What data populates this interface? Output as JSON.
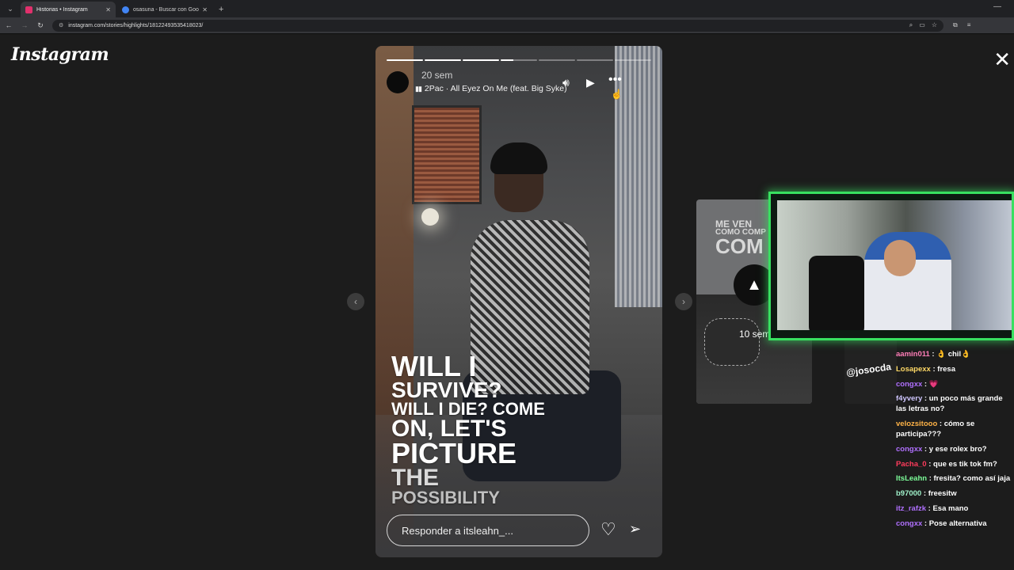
{
  "browser": {
    "tabs": [
      {
        "title": "Historias • Instagram",
        "active": true,
        "favicon_color": "#e1306c"
      },
      {
        "title": "osasuna - Buscar con Google",
        "active": false,
        "favicon_color": "#4285f4"
      }
    ],
    "url": "instagram.com/stories/highlights/18122493535418023/"
  },
  "page": {
    "logo": "Instagram"
  },
  "story": {
    "time": "20 sem",
    "music": "2Pac · All Eyez On Me (feat. Big Syke)",
    "progress": [
      1,
      1,
      1,
      0.35,
      0,
      0,
      0
    ],
    "lyrics": [
      {
        "text": "WILL I",
        "size": 36
      },
      {
        "text": "SURVIVE?",
        "size": 28
      },
      {
        "text": "WILL I DIE? COME",
        "size": 22
      },
      {
        "text": "ON, LET'S",
        "size": 30
      },
      {
        "text": "PICTURE",
        "size": 36
      },
      {
        "text": "THE",
        "size": 30
      },
      {
        "text": "POSSIBILITY",
        "size": 22
      }
    ],
    "reply_placeholder": "Responder a itsleahn_..."
  },
  "next_preview": {
    "text_lines": [
      "ME VEN",
      "COMO COMP",
      "COM"
    ],
    "time": "10 sem",
    "handle": "@josocda"
  },
  "chat": [
    {
      "user": "aamin011",
      "color": "#ff7eb8",
      "text": "👌 chil👌"
    },
    {
      "user": "Losapexx",
      "color": "#ffd966",
      "text": "fresa"
    },
    {
      "user": "congxx",
      "color": "#b070ff",
      "text": "💗"
    },
    {
      "user": "f4yvery",
      "color": "#cfc6ff",
      "text": "un poco más grande las letras no?"
    },
    {
      "user": "velozsitooo",
      "color": "#ffb347",
      "text": "cómo se participa???"
    },
    {
      "user": "congxx",
      "color": "#b070ff",
      "text": "y ese rolex bro?"
    },
    {
      "user": "Pacha_0",
      "color": "#ff3b5c",
      "text": "que es tik tok fm?"
    },
    {
      "user": "ItsLeahn",
      "color": "#7dff9a",
      "text": "fresita? como así jaja"
    },
    {
      "user": "b97000",
      "color": "#9ff0c9",
      "text": "freesitw"
    },
    {
      "user": "itz_rafzk",
      "color": "#b070ff",
      "text": "Esa mano"
    },
    {
      "user": "congxx",
      "color": "#b070ff",
      "text": "Pose alternativa"
    }
  ]
}
